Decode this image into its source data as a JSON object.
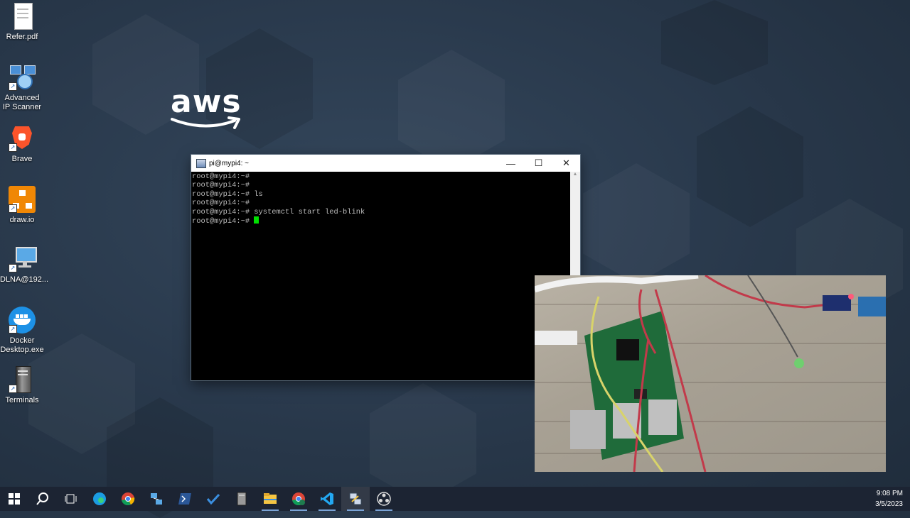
{
  "desktop": {
    "icons": [
      {
        "label": "Refer.pdf",
        "icon": "pdf-file-icon"
      },
      {
        "label": "Advanced IP Scanner",
        "icon": "network-scanner-icon"
      },
      {
        "label": "Brave",
        "icon": "brave-lion-icon"
      },
      {
        "label": "draw.io",
        "icon": "drawio-icon"
      },
      {
        "label": "DLNA@192...",
        "icon": "network-computer-icon"
      },
      {
        "label": "Docker Desktop.exe",
        "icon": "docker-whale-icon"
      },
      {
        "label": "Terminals",
        "icon": "server-tower-icon"
      }
    ],
    "logo": "aws"
  },
  "terminal": {
    "title": "pi@mypi4: ~",
    "lines": [
      "root@mypi4:~#",
      "root@mypi4:~#",
      "root@mypi4:~# ls",
      "root@mypi4:~#",
      "root@mypi4:~# systemctl start led-blink"
    ],
    "prompt": "root@mypi4:~# ",
    "text_color": "#bbbbbb",
    "cursor_color": "#00e000"
  },
  "camera": {
    "icon": "camera-feed-raspberry-pi"
  },
  "taskbar": {
    "items": [
      {
        "icon": "windows-start-icon"
      },
      {
        "icon": "search-icon"
      },
      {
        "icon": "task-view-icon"
      },
      {
        "icon": "edge-browser-icon"
      },
      {
        "icon": "chrome-icon"
      },
      {
        "icon": "network-app-icon"
      },
      {
        "icon": "powershell-icon"
      },
      {
        "icon": "todo-check-icon"
      },
      {
        "icon": "server-app-icon"
      },
      {
        "icon": "file-explorer-icon"
      },
      {
        "icon": "chrome-profile-icon"
      },
      {
        "icon": "vscode-icon"
      },
      {
        "icon": "putty-icon"
      },
      {
        "icon": "obs-icon"
      }
    ],
    "time": "9:08 PM",
    "date": "3/5/2023"
  }
}
